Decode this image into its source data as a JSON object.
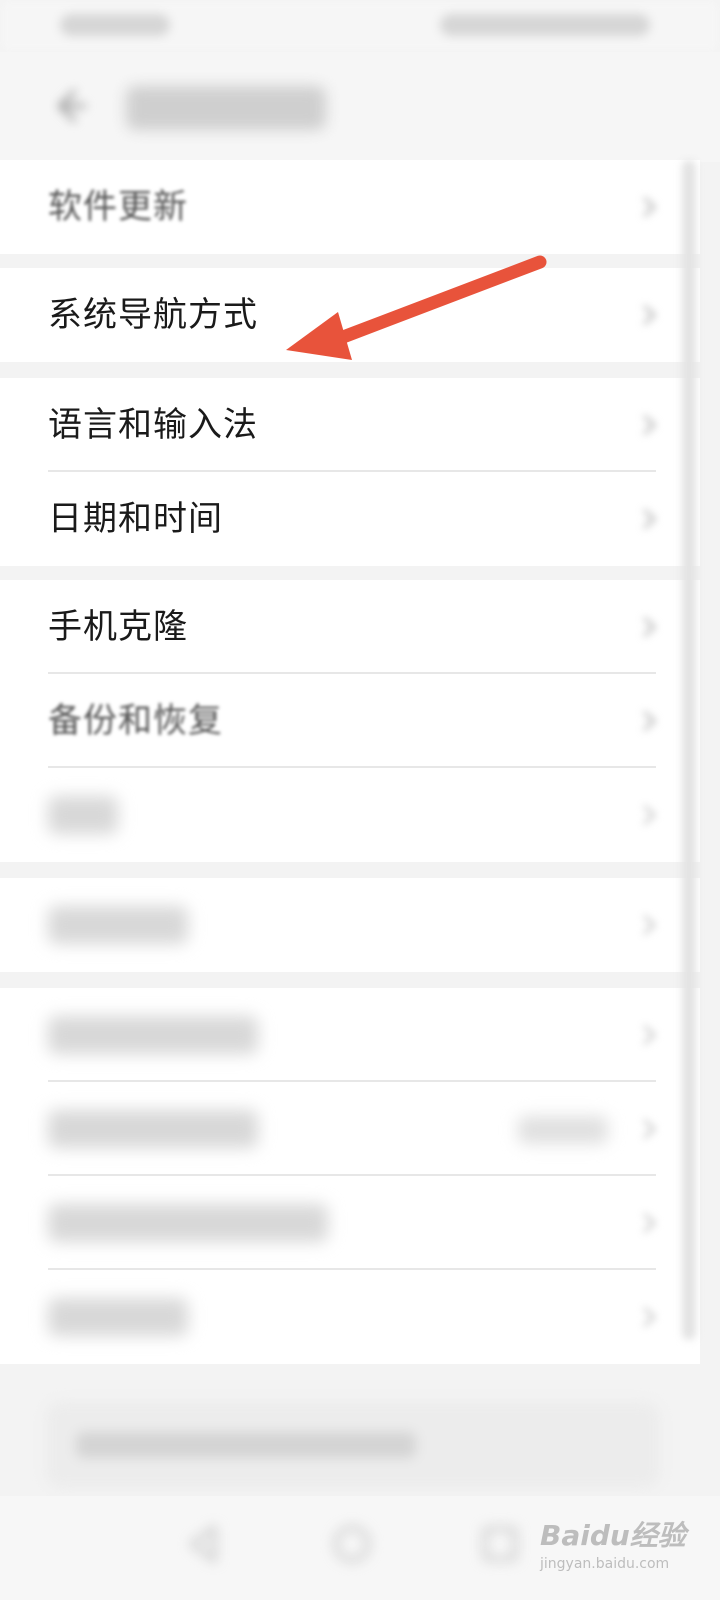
{
  "settings_list": {
    "groups": [
      {
        "items": [
          {
            "label": "软件更新",
            "style": "soft"
          }
        ]
      },
      {
        "items": [
          {
            "label": "系统导航方式",
            "style": "clear"
          }
        ]
      },
      {
        "items": [
          {
            "label": "语言和输入法",
            "style": "clear"
          },
          {
            "label": "日期和时间",
            "style": "clear"
          }
        ]
      },
      {
        "items": [
          {
            "label": "手机克隆",
            "style": "clear"
          },
          {
            "label": "备份和恢复",
            "style": "soft"
          }
        ]
      }
    ]
  },
  "watermark": {
    "brand": "Baidu经验",
    "sub": "jingyan.baidu.com"
  },
  "colors": {
    "annotation_arrow": "#e8533b",
    "row_background": "#ffffff",
    "page_background": "#f3f3f3"
  },
  "icons": {
    "back": "arrow-left-icon",
    "chevron": "chevron-right-icon",
    "nav_back": "triangle-back-icon",
    "nav_home": "circle-home-icon",
    "nav_recent": "square-recent-icon"
  }
}
